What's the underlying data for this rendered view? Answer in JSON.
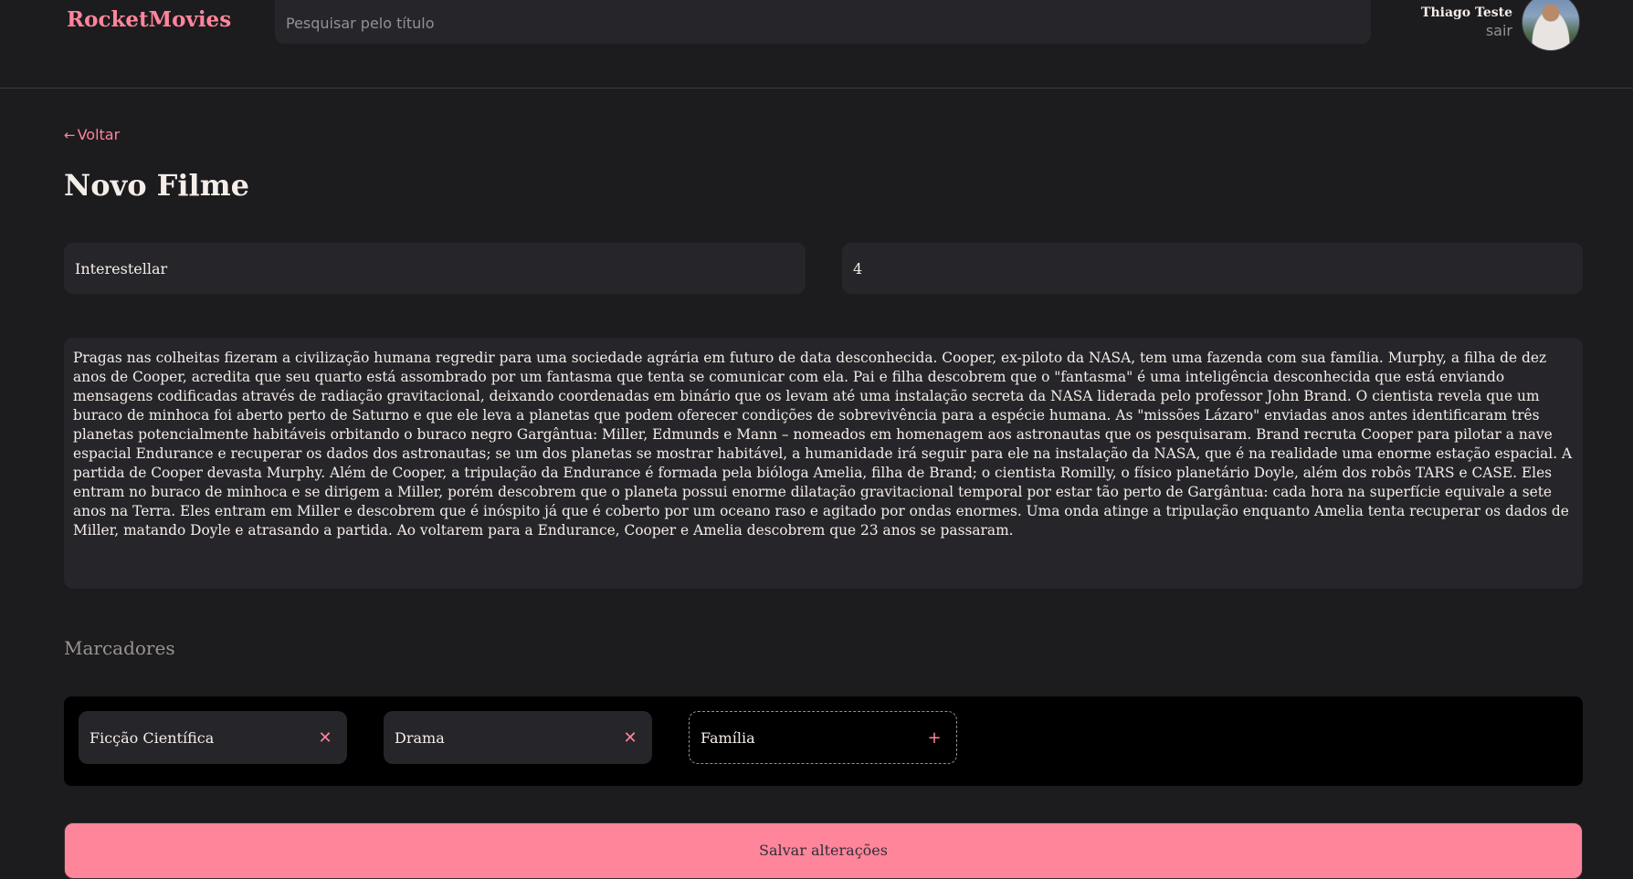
{
  "header": {
    "brand": "RocketMovies",
    "search_placeholder": "Pesquisar pelo título",
    "user_name": "Thiago Teste",
    "logout_label": "sair"
  },
  "page": {
    "back_label": "Voltar",
    "title": "Novo Filme"
  },
  "form": {
    "title_value": "Interestellar",
    "rating_value": "4",
    "description": "Pragas nas colheitas fizeram a civilização humana regredir para uma sociedade agrária em futuro de data desconhecida. Cooper, ex-piloto da NASA, tem uma fazenda com sua família. Murphy, a filha de dez anos de Cooper, acredita que seu quarto está assombrado por um fantasma que tenta se comunicar com ela. Pai e filha descobrem que o \"fantasma\" é uma inteligência desconhecida que está enviando mensagens codificadas através de radiação gravitacional, deixando coordenadas em binário que os levam até uma instalação secreta da NASA liderada pelo professor John Brand. O cientista revela que um buraco de minhoca foi aberto perto de Saturno e que ele leva a planetas que podem oferecer condições de sobrevivência para a espécie humana. As \"missões Lázaro\" enviadas anos antes identificaram três planetas potencialmente habitáveis orbitando o buraco negro Gargântua: Miller, Edmunds e Mann – nomeados em homenagem aos astronautas que os pesquisaram. Brand recruta Cooper para pilotar a nave espacial Endurance e recuperar os dados dos astronautas; se um dos planetas se mostrar habitável, a humanidade irá seguir para ele na instalação da NASA, que é na realidade uma enorme estação espacial. A partida de Cooper devasta Murphy. Além de Cooper, a tripulação da Endurance é formada pela bióloga Amelia, filha de Brand; o cientista Romilly, o físico planetário Doyle, além dos robôs TARS e CASE. Eles entram no buraco de minhoca e se dirigem a Miller, porém descobrem que o planeta possui enorme dilatação gravitacional temporal por estar tão perto de Gargântua: cada hora na superfície equivale a sete anos na Terra. Eles entram em Miller e descobrem que é inóspito já que é coberto por um oceano raso e agitado por ondas enormes. Uma onda atinge a tripulação enquanto Amelia tenta recuperar os dados de Miller, matando Doyle e atrasando a partida. Ao voltarem para a Endurance, Cooper e Amelia descobrem que 23 anos se passaram."
  },
  "tags": {
    "section_title": "Marcadores",
    "items": [
      {
        "label": "Ficção Científica",
        "icon": "close-icon",
        "glyph": "✕"
      },
      {
        "label": "Drama",
        "icon": "close-icon",
        "glyph": "✕"
      }
    ],
    "new_tag": {
      "label": "Família",
      "icon": "plus-icon",
      "glyph": "+"
    }
  },
  "actions": {
    "save_label": "Salvar alterações"
  },
  "colors": {
    "accent": "#ff859b",
    "background": "#1c1b1e",
    "input_bg": "#262529"
  }
}
